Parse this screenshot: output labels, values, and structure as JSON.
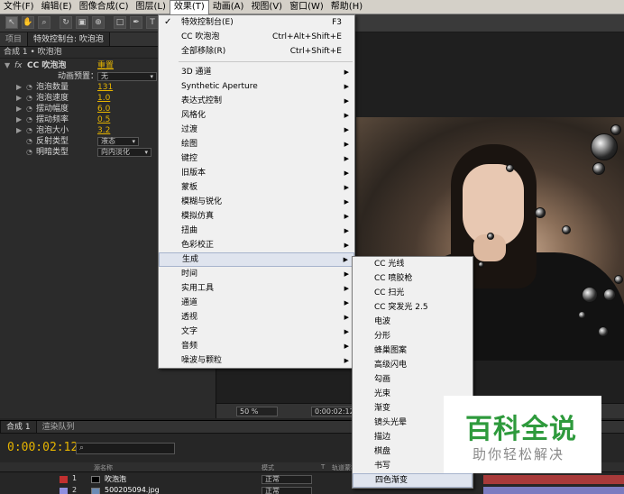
{
  "menubar": {
    "items": [
      "文件(F)",
      "编辑(E)",
      "图像合成(C)",
      "图层(L)",
      "效果(T)",
      "动画(A)",
      "视图(V)",
      "窗口(W)",
      "帮助(H)"
    ]
  },
  "project_panel": {
    "tabs": [
      "项目",
      "特效控制台: 吹泡泡"
    ],
    "breadcrumb": "合成 1 • 吹泡泡",
    "effect_name": "CC 吹泡泡",
    "reset_label": "重置",
    "preset_label": "动画预置：",
    "preset_value": "无",
    "properties": [
      {
        "label": "泡泡数量",
        "value": "131"
      },
      {
        "label": "泡泡速度",
        "value": "1.0"
      },
      {
        "label": "摆动幅度",
        "value": "6.0"
      },
      {
        "label": "摆动频率",
        "value": "0.5"
      },
      {
        "label": "泡泡大小",
        "value": "3.2"
      }
    ],
    "selects": [
      {
        "label": "反射类型",
        "value": "液态"
      },
      {
        "label": "明暗类型",
        "value": "向内淡化"
      }
    ]
  },
  "effects_menu": {
    "items": [
      {
        "label": "特效控制台(E)",
        "shortcut": "F3",
        "checked": true
      },
      {
        "label": "CC 吹泡泡",
        "shortcut": "Ctrl+Alt+Shift+E"
      },
      {
        "label": "全部移除(R)",
        "shortcut": "Ctrl+Shift+E"
      },
      {
        "label": "3D 通道"
      },
      {
        "label": "Synthetic Aperture"
      },
      {
        "label": "表达式控制"
      },
      {
        "label": "风格化"
      },
      {
        "label": "过渡"
      },
      {
        "label": "绘图"
      },
      {
        "label": "键控"
      },
      {
        "label": "旧版本"
      },
      {
        "label": "蒙板"
      },
      {
        "label": "模糊与锐化"
      },
      {
        "label": "模拟仿真"
      },
      {
        "label": "扭曲"
      },
      {
        "label": "色彩校正"
      },
      {
        "label": "生成"
      },
      {
        "label": "时间"
      },
      {
        "label": "实用工具"
      },
      {
        "label": "通道"
      },
      {
        "label": "透视"
      },
      {
        "label": "文字"
      },
      {
        "label": "音频"
      },
      {
        "label": "噪波与颗粒"
      }
    ]
  },
  "generate_menu": {
    "items": [
      "CC 光线",
      "CC 喷胶枪",
      "CC 扫光",
      "CC 突发光 2.5",
      "电波",
      "分形",
      "蜂巢图案",
      "高级闪电",
      "勾画",
      "光束",
      "渐变",
      "镜头光晕",
      "描边",
      "棋盘",
      "书写",
      "四色渐变"
    ]
  },
  "viewer": {
    "zoom": "50 %",
    "timecode": "0:00:02:12"
  },
  "timeline": {
    "tabs": [
      "合成 1",
      "渲染队列"
    ],
    "timecode": "0:00:02:12",
    "columns": [
      "源名称",
      "模式",
      "T",
      "轨道蒙板"
    ],
    "layers": [
      {
        "num": "1",
        "name": "吹泡泡",
        "mode": "正常",
        "label_color": "#c03030"
      },
      {
        "num": "2",
        "name": "500205094.jpg",
        "mode": "正常",
        "label_color": "#8f8fe0"
      }
    ]
  },
  "watermark": {
    "line1": "百科全说",
    "line2": "助你轻松解决"
  }
}
